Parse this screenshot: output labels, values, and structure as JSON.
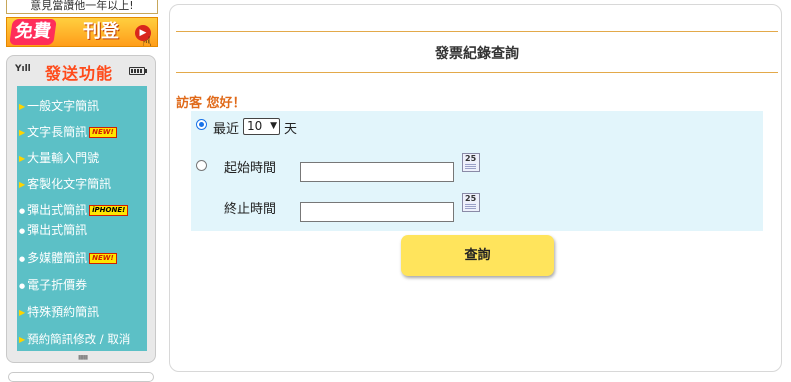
{
  "ad": {
    "top_text": "意見當讚他一年以上!",
    "free_label": "免費",
    "publish_label": "刊登"
  },
  "menu": {
    "title": "發送功能",
    "signal_text": "Yıll",
    "items": [
      {
        "label": "一般文字簡訊",
        "marker": "triangle",
        "badge": ""
      },
      {
        "label": "文字長簡訊",
        "marker": "triangle",
        "badge": "NEW!"
      },
      {
        "label": "大量輸入門號",
        "marker": "triangle",
        "badge": ""
      },
      {
        "label": "客製化文字簡訊",
        "marker": "triangle",
        "badge": ""
      },
      {
        "label": "彈出式簡訊",
        "marker": "dot",
        "badge": "iPHONE!"
      },
      {
        "label": "彈出式簡訊",
        "marker": "dot",
        "badge": ""
      },
      {
        "label": "多媒體簡訊",
        "marker": "dot",
        "badge": "NEW!"
      },
      {
        "label": "電子折價券",
        "marker": "dot",
        "badge": ""
      },
      {
        "label": "特殊預約簡訊",
        "marker": "triangle",
        "badge": ""
      },
      {
        "label": "預約簡訊修改 / 取消",
        "marker": "triangle",
        "badge": ""
      }
    ]
  },
  "page": {
    "title": "發票紀錄查詢",
    "greeting": "訪客 您好！"
  },
  "form": {
    "recent_label": "最近",
    "days_value": "10",
    "days_unit": "天",
    "start_label": "起始時間",
    "end_label": "終止時間",
    "calendar_day": "25",
    "start_value": "",
    "end_value": "",
    "recent_selected": true
  },
  "query_button": "查詢",
  "colors": {
    "menu_bg": "#5cc0c6",
    "form_bg": "#e2f5fb",
    "button_bg": "#ffe45c",
    "rule_line": "#e3a94a",
    "greeting": "#e06a1a"
  }
}
